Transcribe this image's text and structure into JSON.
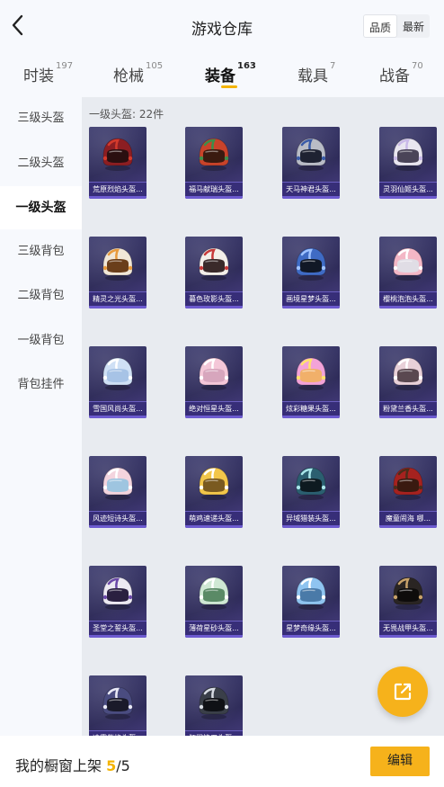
{
  "header": {
    "title": "游戏仓库",
    "sort_options": [
      "品质",
      "最新"
    ]
  },
  "tabs": [
    {
      "label": "时装",
      "count": "197"
    },
    {
      "label": "枪械",
      "count": "105"
    },
    {
      "label": "装备",
      "count": "163"
    },
    {
      "label": "载具",
      "count": "7"
    },
    {
      "label": "战备",
      "count": "70"
    }
  ],
  "sidebar": {
    "items": [
      {
        "label": "三级头盔"
      },
      {
        "label": "二级头盔"
      },
      {
        "label": "一级头盔"
      },
      {
        "label": "三级背包"
      },
      {
        "label": "二级背包"
      },
      {
        "label": "一级背包"
      },
      {
        "label": "背包挂件"
      }
    ],
    "selected": "一级头盔"
  },
  "content": {
    "count_label": "一级头盔: 22件",
    "items": [
      {
        "name": "荒原烈焰头盔...",
        "shell": "#8c1e22",
        "accent": "#d33a2c",
        "visor": "#2a0f10"
      },
      {
        "name": "福马献瑞头盔...",
        "shell": "#c8432a",
        "accent": "#3b8f4a",
        "visor": "#3a1a10"
      },
      {
        "name": "天马神君头盔...",
        "shell": "#b9bcc6",
        "accent": "#3a5ba8",
        "visor": "#1e2232"
      },
      {
        "name": "灵羽仙姬头盔...",
        "shell": "#e9e6f0",
        "accent": "#c9b9e8",
        "visor": "#4a4458"
      },
      {
        "name": "精灵之光头盔...",
        "shell": "#f1e7d7",
        "accent": "#e89a3c",
        "visor": "#6a3e1a"
      },
      {
        "name": "暮色玫影头盔...",
        "shell": "#f3efe9",
        "accent": "#c83a3a",
        "visor": "#3a2a2a"
      },
      {
        "name": "画境星梦头盔...",
        "shell": "#3f6bc4",
        "accent": "#9fc2ff",
        "visor": "#111826"
      },
      {
        "name": "樱桃泡泡头盔...",
        "shell": "#f3b7c6",
        "accent": "#ffffff",
        "visor": "#e0dde5"
      },
      {
        "name": "雪国风尚头盔...",
        "shell": "#cfe0f5",
        "accent": "#ffffff",
        "visor": "#a7c3e6"
      },
      {
        "name": "绝对恒星头盔...",
        "shell": "#f4c7d8",
        "accent": "#ffffff",
        "visor": "#d7a6bd"
      },
      {
        "name": "炫彩糖果头盔...",
        "shell": "#f3a3d8",
        "accent": "#ffe46a",
        "visor": "#f1b06a"
      },
      {
        "name": "粉黛兰香头盔...",
        "shell": "#e8d0d8",
        "accent": "#ffffff",
        "visor": "#5a4850"
      },
      {
        "name": "风迹短诗头盔...",
        "shell": "#f3d4de",
        "accent": "#ffffff",
        "visor": "#9ec5e0"
      },
      {
        "name": "萌鸡速递头盔...",
        "shell": "#f2c64a",
        "accent": "#ffffff",
        "visor": "#7a5a20"
      },
      {
        "name": "异域猎装头盔...",
        "shell": "#2b5f70",
        "accent": "#a9e6ea",
        "visor": "#0e1a20"
      },
      {
        "name": "魔童闹海 哪...",
        "shell": "#a6221f",
        "accent": "#4b2d1a",
        "visor": "#3a1a10"
      },
      {
        "name": "圣堂之誓头盔...",
        "shell": "#ece9f2",
        "accent": "#6b49a8",
        "visor": "#2a2040"
      },
      {
        "name": "薄荷星砂头盔...",
        "shell": "#cfe8d4",
        "accent": "#ffffff",
        "visor": "#5a8a66"
      },
      {
        "name": "星梦奇缘头盔...",
        "shell": "#8fc4f0",
        "accent": "#ffffff",
        "visor": "#4a7aa8"
      },
      {
        "name": "无畏战甲头盔...",
        "shell": "#2a2523",
        "accent": "#c8a26a",
        "visor": "#0e0c0b"
      },
      {
        "name": "凌霄紫焰头盔...",
        "shell": "#4a4c80",
        "accent": "#e9e9f5",
        "visor": "#1a1a2a"
      },
      {
        "name": "狂鲨锋刃头盔...",
        "shell": "#3a3f49",
        "accent": "#d7dbe3",
        "visor": "#0f1116"
      }
    ]
  },
  "bottom_bar": {
    "label": "我的橱窗上架",
    "current": "5",
    "total": "/5",
    "edit_label": "编辑"
  },
  "colors": {
    "accent": "#f6b21b",
    "card_bg": "#34306a"
  }
}
